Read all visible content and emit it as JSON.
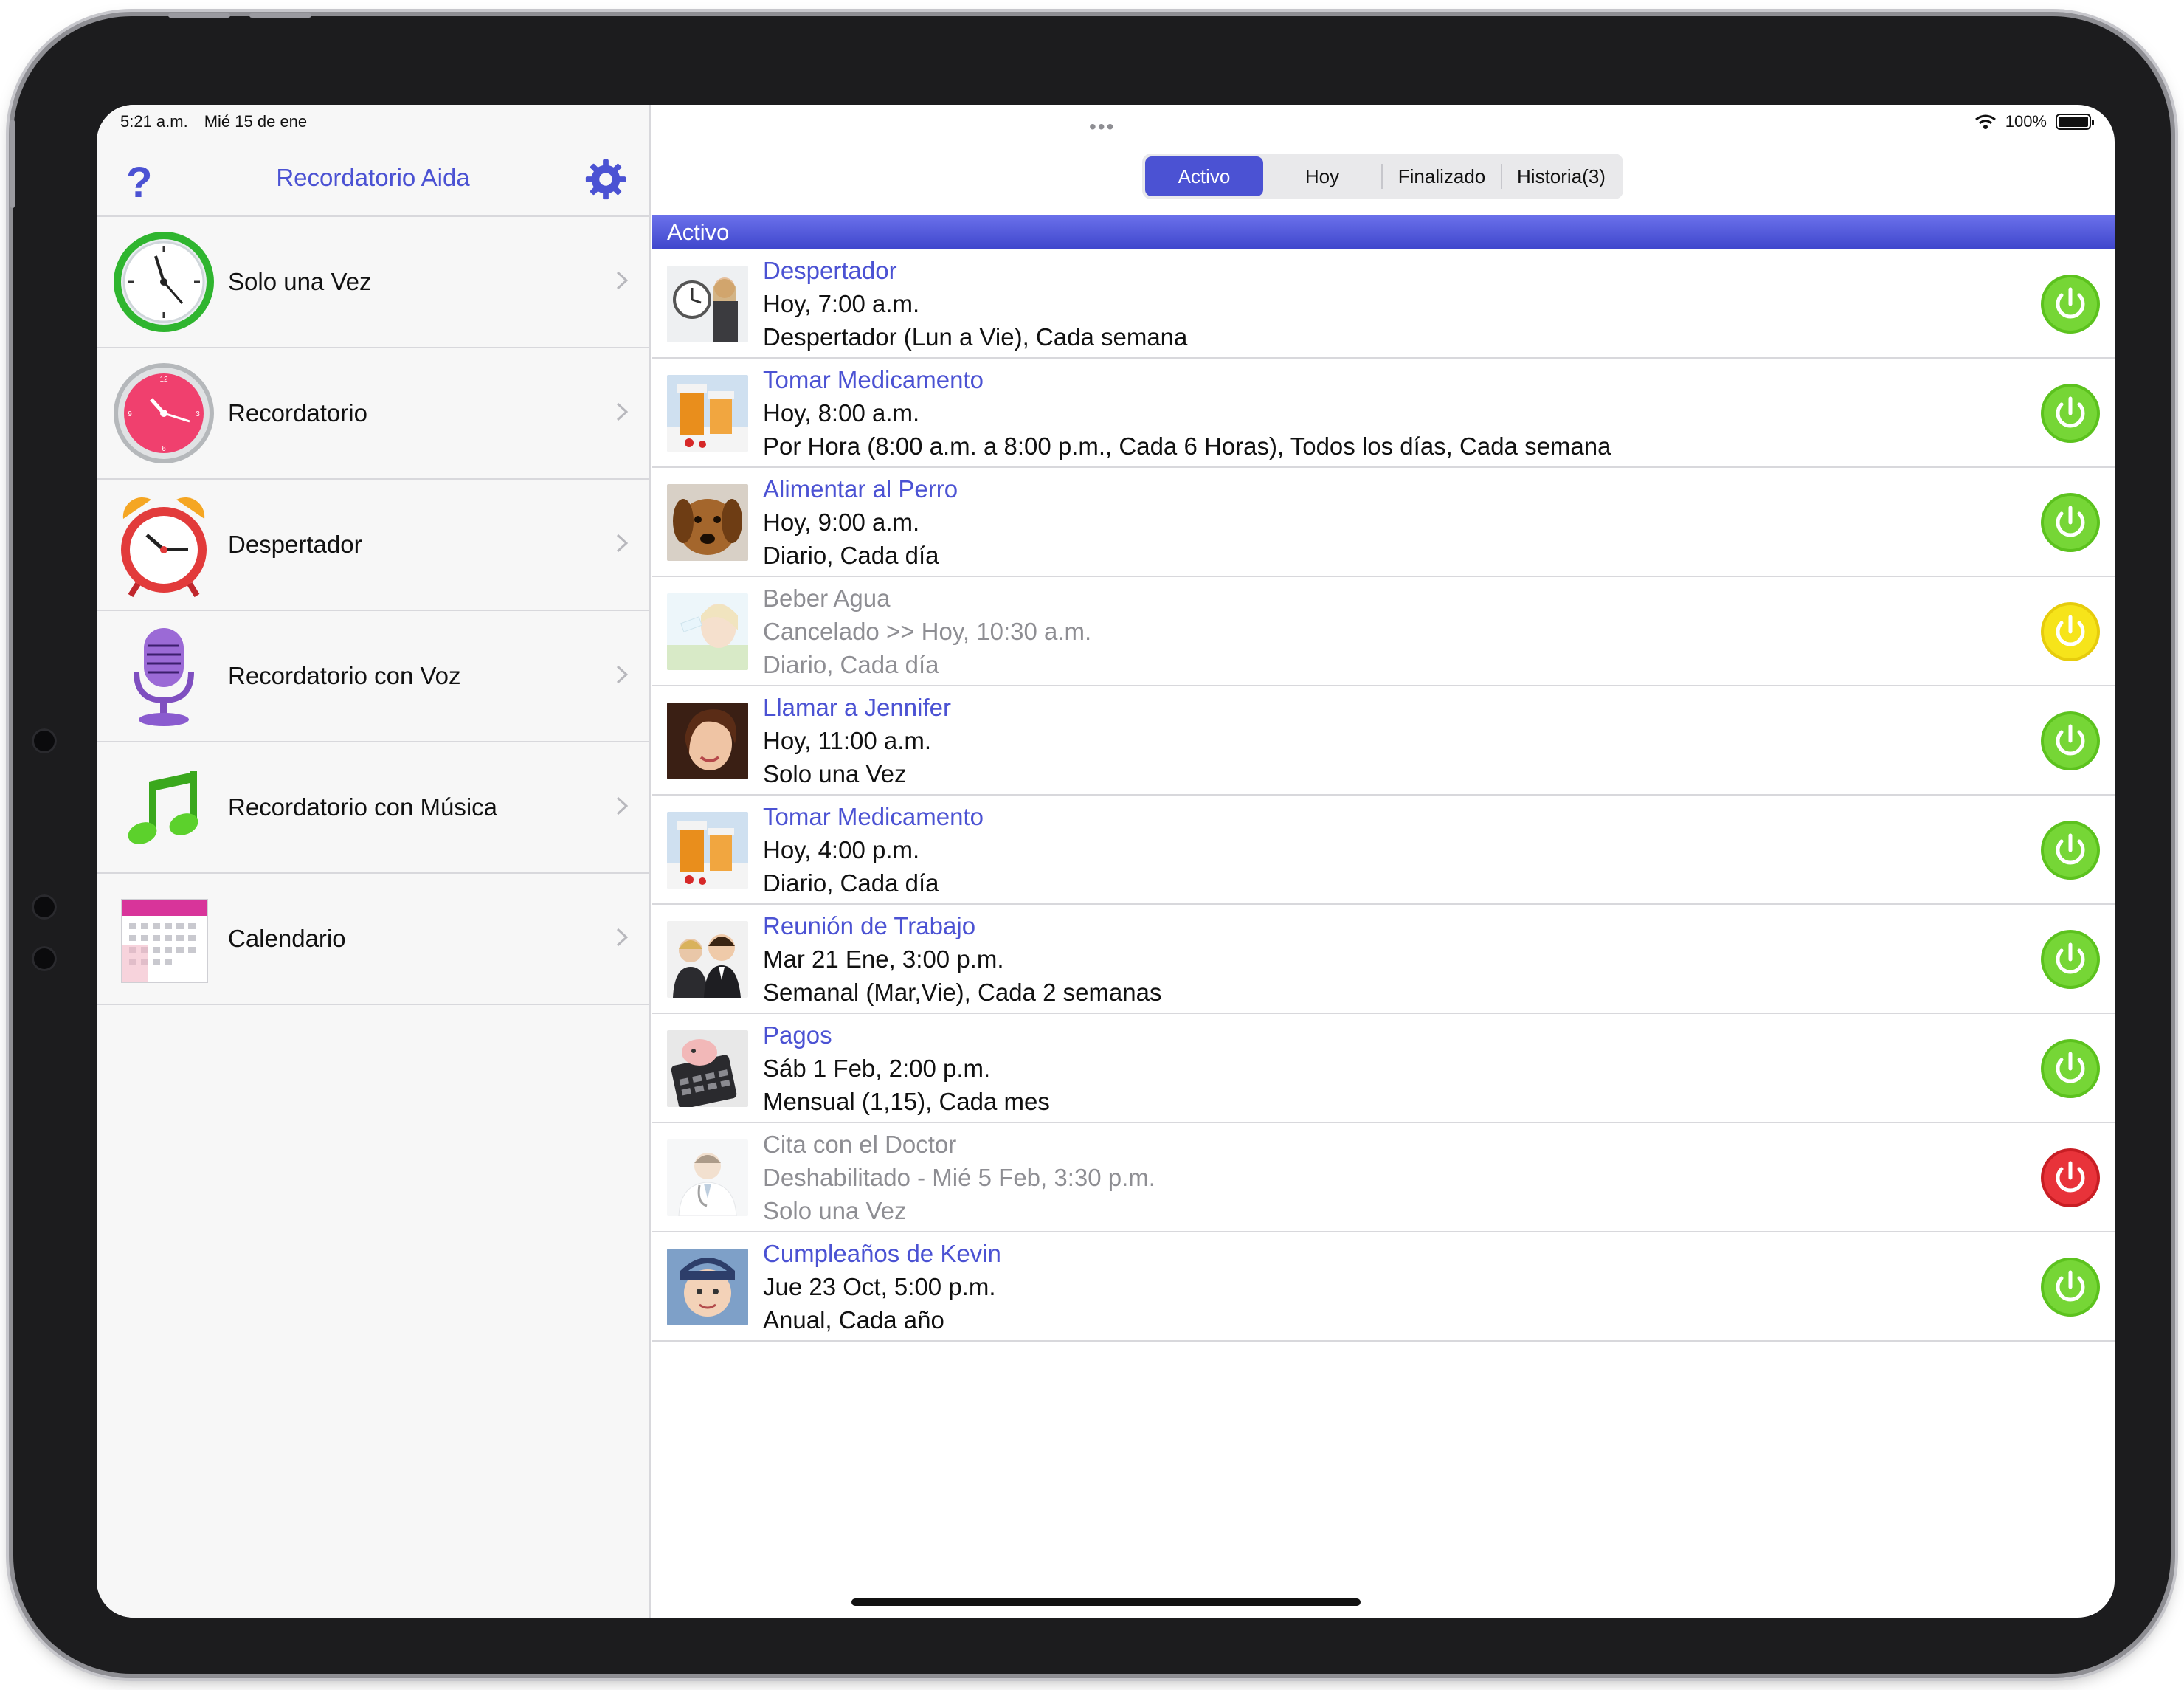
{
  "status": {
    "time": "5:21 a.m.",
    "date": "Mié 15 de ene",
    "battery": "100%"
  },
  "sidebar": {
    "title": "Recordatorio Aida",
    "help_label": "?",
    "items": [
      {
        "label": "Solo una Vez",
        "icon": "stopwatch-icon"
      },
      {
        "label": "Recordatorio",
        "icon": "pink-clock-icon"
      },
      {
        "label": "Despertador",
        "icon": "alarm-clock-icon"
      },
      {
        "label": "Recordatorio con Voz",
        "icon": "microphone-icon"
      },
      {
        "label": "Recordatorio con Música",
        "icon": "music-note-icon"
      },
      {
        "label": "Calendario",
        "icon": "calendar-icon"
      }
    ]
  },
  "tabs": [
    {
      "label": "Activo",
      "active": true
    },
    {
      "label": "Hoy",
      "active": false
    },
    {
      "label": "Finalizado",
      "active": false
    },
    {
      "label": "Historia(3)",
      "active": false
    }
  ],
  "section_title": "Activo",
  "reminders": [
    {
      "title": "Despertador",
      "line1": "Hoy, 7:00 a.m.",
      "line2": "Despertador (Lun a Vie), Cada semana",
      "state": "on",
      "thumb": "alarm-woman-thumb"
    },
    {
      "title": "Tomar Medicamento",
      "line1": "Hoy, 8:00 a.m.",
      "line2": "Por Hora (8:00 a.m. a 8:00 p.m., Cada 6 Horas), Todos los días, Cada semana",
      "state": "on",
      "thumb": "pills-thumb"
    },
    {
      "title": "Alimentar al Perro",
      "line1": "Hoy, 9:00 a.m.",
      "line2": "Diario, Cada día",
      "state": "on",
      "thumb": "dog-thumb"
    },
    {
      "title": "Beber Agua",
      "line1": "Cancelado >> Hoy, 10:30 a.m.",
      "line2": "Diario, Cada día",
      "state": "cancelled",
      "thumb": "drinking-water-thumb"
    },
    {
      "title": "Llamar a Jennifer",
      "line1": "Hoy, 11:00 a.m.",
      "line2": "Solo una Vez",
      "state": "on",
      "thumb": "woman-phone-thumb"
    },
    {
      "title": "Tomar Medicamento",
      "line1": "Hoy, 4:00 p.m.",
      "line2": "Diario, Cada día",
      "state": "on",
      "thumb": "pills-thumb"
    },
    {
      "title": "Reunión de Trabajo",
      "line1": "Mar 21 Ene, 3:00 p.m.",
      "line2": "Semanal (Mar,Vie), Cada 2 semanas",
      "state": "on",
      "thumb": "business-people-thumb"
    },
    {
      "title": "Pagos",
      "line1": "Sáb 1 Feb, 2:00 p.m.",
      "line2": "Mensual (1,15), Cada mes",
      "state": "on",
      "thumb": "piggy-calculator-thumb"
    },
    {
      "title": "Cita con el Doctor",
      "line1": "Deshabilitado - Mié 5 Feb, 3:30 p.m.",
      "line2": "Solo una Vez",
      "state": "disabled",
      "thumb": "doctor-thumb"
    },
    {
      "title": "Cumpleaños de Kevin",
      "line1": "Jue 23 Oct, 5:00 p.m.",
      "line2": "Anual, Cada año",
      "state": "on",
      "thumb": "baby-thumb"
    }
  ],
  "colors": {
    "accent": "#4b52d3",
    "power_on": "#5cc21e",
    "power_cancelled": "#f2dc12",
    "power_disabled": "#e0242b"
  }
}
